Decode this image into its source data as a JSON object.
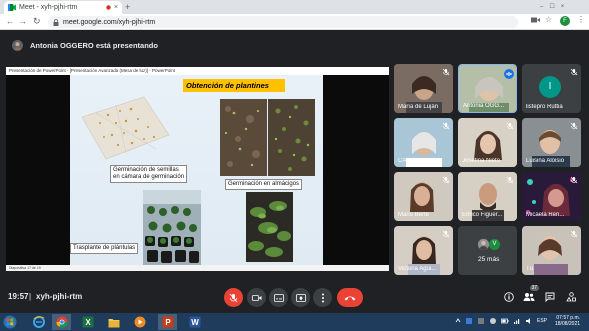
{
  "browser": {
    "tab_title": "Meet - xyh-pjhi-rtm",
    "url": "meet.google.com/xyh-pjhi-rtm",
    "profile_initial": "F"
  },
  "meet": {
    "presenter_banner": "Antonia OGGERO está presentando",
    "clock": "19:57",
    "separator": "|",
    "meeting_code": "xyh-pjhi-rtm",
    "participants_badge": "37"
  },
  "presentation": {
    "window_title": "Presentación de PowerPoint - [Presentación Avanzada (Mesa de luz)] - PowerPoint",
    "slide_title": "Obtención de plantines",
    "captions": {
      "germination_chamber": "Germinación de semillas\nen cámara de germinación",
      "germination_seedbeds": "Germinación en almácigos",
      "transplant": "Trasplante  de plántulas"
    },
    "status": "Diapositiva 17 de 19"
  },
  "participants": [
    {
      "name": "María de Luján",
      "initial": ""
    },
    {
      "name": "Antonia OGG...",
      "initial": ""
    },
    {
      "name": "listepro Ruttia",
      "initial": "I",
      "color": "#009688"
    },
    {
      "name": "CARLA RITA T...",
      "initial": ""
    },
    {
      "name": "Josefina Nieto",
      "initial": ""
    },
    {
      "name": "Luisina Aloisio",
      "initial": ""
    },
    {
      "name": "Mario Berte",
      "initial": ""
    },
    {
      "name": "Enrico Figuer...",
      "initial": ""
    },
    {
      "name": "Micaela Ren...",
      "initial": ""
    },
    {
      "name": "Victoria Agui...",
      "initial": ""
    },
    {
      "name": "25 más",
      "initial": "V",
      "color": "#1e8e3e"
    },
    {
      "name": "Tú",
      "initial": ""
    }
  ],
  "taskbar": {
    "time": "07:57 p.m.",
    "date": "18/08/2021"
  },
  "colors": {
    "meet_bg": "#202124",
    "tile_bg": "#3c4043",
    "end_call_red": "#ea4335",
    "active_speaker_blue": "#8ab4f8",
    "slide_title_bg": "#ffc000"
  }
}
